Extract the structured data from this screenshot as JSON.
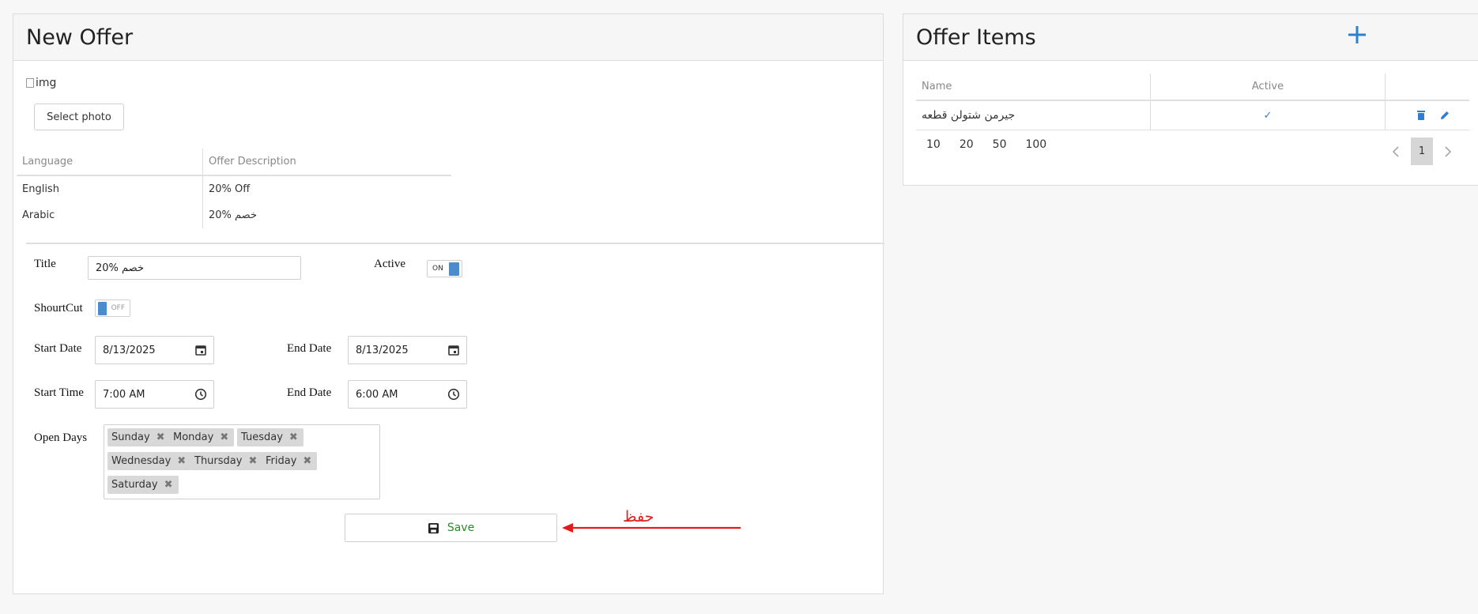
{
  "new_offer": {
    "title": "New Offer",
    "image_alt": "img",
    "select_photo_label": "Select photo",
    "descriptions_table": {
      "headers": [
        "Language",
        "Offer Description"
      ],
      "rows": [
        [
          "English",
          "20% Off"
        ],
        [
          "Arabic",
          "20% خصم"
        ]
      ]
    },
    "form": {
      "title_label": "Title",
      "title_value": "20% خصم",
      "active_label": "Active",
      "active_toggle": "ON",
      "shortcut_label": "ShourtCut",
      "shortcut_toggle": "OFF",
      "start_date_label": "Start Date",
      "start_date_value": "8/13/2025",
      "end_date_label": "End Date",
      "end_date_value": "8/13/2025",
      "start_time_label": "Start Time",
      "start_time_value": "7:00 AM",
      "end_time_label": "End Date",
      "end_time_value": "6:00 AM",
      "open_days_label": "Open Days",
      "open_days": [
        "Sunday",
        "Monday",
        "Tuesday",
        "Wednesday",
        "Thursday",
        "Friday",
        "Saturday"
      ]
    },
    "save_label": "Save",
    "annotation_text": "حفظ"
  },
  "offer_items": {
    "title": "Offer Items",
    "add_icon": "plus-icon",
    "headers": [
      "Name",
      "Active",
      ""
    ],
    "rows": [
      {
        "name": "جيرمن شتولن قطعه",
        "active": "✓"
      }
    ],
    "page_sizes": [
      "10",
      "20",
      "50",
      "100"
    ],
    "current_page": "1"
  },
  "colors": {
    "accent": "#2d7fd0",
    "toggle": "#4a8ccd",
    "save_text": "#2a8a2a",
    "annotation": "#e31b1b"
  }
}
